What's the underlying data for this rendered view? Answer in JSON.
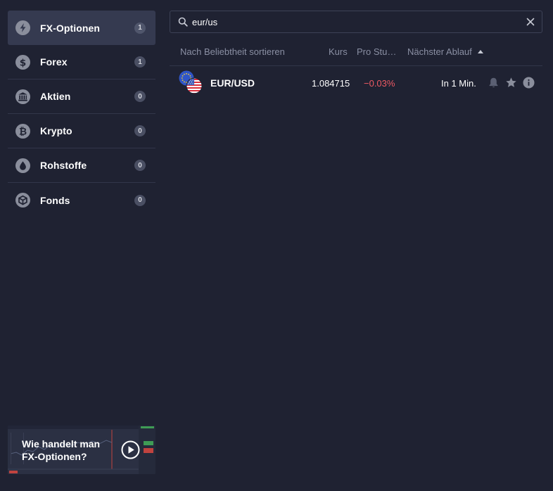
{
  "sidebar": {
    "items": [
      {
        "label": "FX-Optionen",
        "count": "1",
        "icon": "lightning-icon",
        "active": true
      },
      {
        "label": "Forex",
        "count": "1",
        "icon": "dollar-icon",
        "active": false
      },
      {
        "label": "Aktien",
        "count": "0",
        "icon": "bank-icon",
        "active": false
      },
      {
        "label": "Krypto",
        "count": "0",
        "icon": "bitcoin-icon",
        "active": false
      },
      {
        "label": "Rohstoffe",
        "count": "0",
        "icon": "drop-icon",
        "active": false
      },
      {
        "label": "Fonds",
        "count": "0",
        "icon": "box-icon",
        "active": false
      }
    ],
    "promo": {
      "line1": "Wie handelt man",
      "line2": "FX-Optionen?",
      "icon": "play-icon"
    }
  },
  "search": {
    "value": "eur/us",
    "icon": "search-icon",
    "clear_icon": "close-icon"
  },
  "columns": {
    "sort": "Nach Beliebtheit sortieren",
    "kurs": "Kurs",
    "pro_stunde": "Pro Stu…",
    "next_expiry": "Nächster Ablauf"
  },
  "results": [
    {
      "pair": "EUR/USD",
      "price": "1.084715",
      "change": "−0.03%",
      "expiry": "In 1 Min.",
      "icons": [
        "eu-flag-icon",
        "us-flag-icon",
        "bell-icon",
        "star-icon",
        "info-icon"
      ]
    }
  ],
  "colors": {
    "background": "#1f2232",
    "active_item": "#353a50",
    "negative": "#ee5a64",
    "muted_text": "#8a8fa3",
    "icon_gray": "#8a8e9c"
  }
}
